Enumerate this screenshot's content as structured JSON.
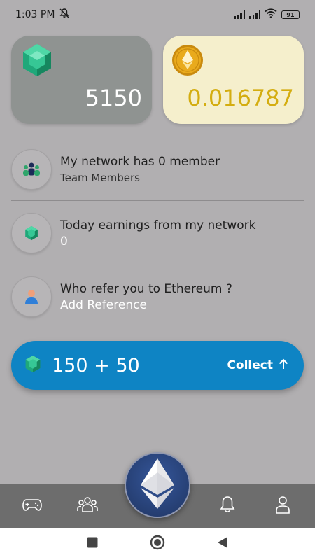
{
  "status_bar": {
    "time": "1:03 PM",
    "battery": "91"
  },
  "balances": {
    "gems": "5150",
    "eth": "0.016787"
  },
  "network": {
    "title": "My network has 0 member",
    "subtitle": "Team Members"
  },
  "earnings": {
    "title": "Today earnings from my network",
    "value": "0"
  },
  "referral": {
    "title": "Who refer you to Ethereum ?",
    "action": "Add Reference"
  },
  "collect": {
    "amount": "150 + 50",
    "label": "Collect"
  },
  "colors": {
    "background": "#b1afb1",
    "gem_card": "#8f9391",
    "eth_card": "#f5efcc",
    "eth_value": "#d4ad10",
    "collect_bar": "#0e84c4",
    "bottom_nav": "#6d6d6d",
    "fab": "#2a4478"
  },
  "icons": {
    "status": [
      "mute-icon",
      "signal-icon",
      "wifi-icon",
      "battery-icon"
    ],
    "cards": [
      "gem-icon",
      "ethereum-coin-icon"
    ],
    "rows": [
      "team-icon",
      "gem-icon",
      "person-icon"
    ],
    "collect": [
      "gem-icon",
      "arrow-up-icon"
    ],
    "bottom_nav": [
      "gamepad-icon",
      "group-icon",
      "ethereum-icon",
      "bell-icon",
      "profile-icon"
    ],
    "system_nav": [
      "recents-square-icon",
      "home-circle-icon",
      "back-triangle-icon"
    ]
  }
}
